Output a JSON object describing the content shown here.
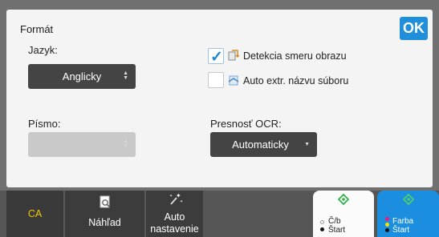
{
  "dialog": {
    "title": "Formát",
    "ok_label": "OK",
    "language": {
      "label": "Jazyk:",
      "value": "Anglicky"
    },
    "font": {
      "label": "Písmo:",
      "value": ""
    },
    "ocr": {
      "label": "Presnosť OCR:",
      "value": "Automaticky"
    },
    "options": [
      {
        "label": "Detekcia smeru obrazu",
        "checked": true
      },
      {
        "label": "Auto extr. názvu súboru",
        "checked": false
      }
    ]
  },
  "bottombar": {
    "ca_label": "CA",
    "preview_label": "Náhľad",
    "auto_label_line1": "Auto",
    "auto_label_line2": "nastavenie",
    "start_bw_line1": "Č/b",
    "start_bw_line2": "Štart",
    "start_color_line1": "Farba",
    "start_color_line2": "Štart"
  },
  "colors": {
    "accent": "#1f8fdc",
    "ca_text": "#f2c600",
    "dropdown_bg": "#444444",
    "start_color_bg": "#1b8ee0",
    "start_icon": "#2fb24a"
  }
}
